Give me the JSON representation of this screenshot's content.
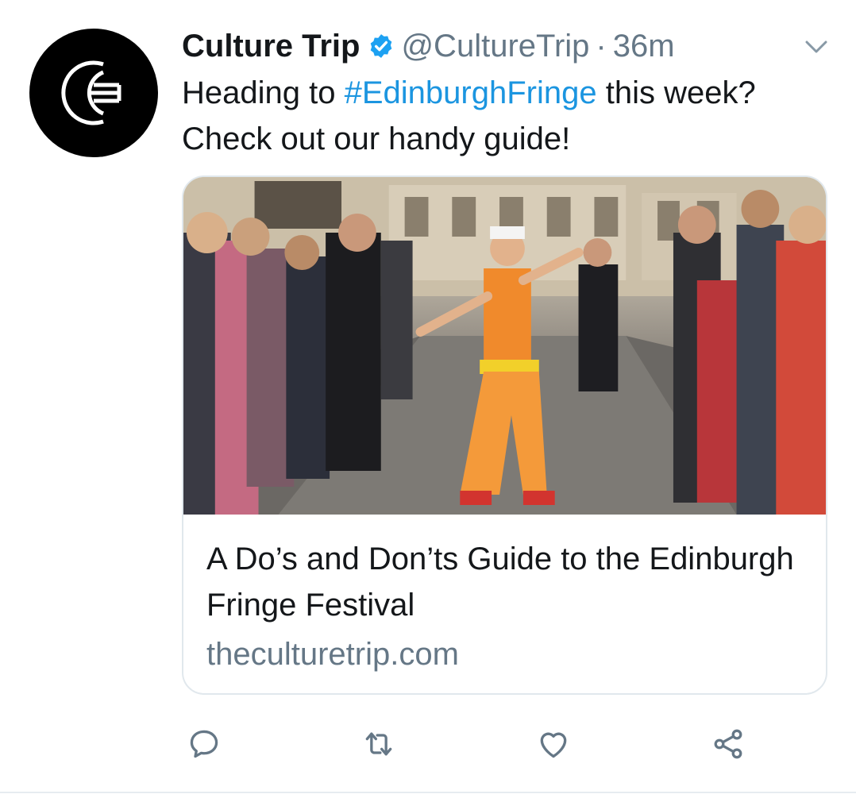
{
  "tweet": {
    "author_name": "Culture Trip",
    "verified": true,
    "handle": "@CultureTrip",
    "separator": "·",
    "time": "36m",
    "text_before": "Heading to ",
    "hashtag": "#EdinburghFringe",
    "text_after": " this week? Check out our handy guide!"
  },
  "card": {
    "title": "A Do’s and Don’ts Guide to the Edinburgh Fringe Festival",
    "domain": "theculturetrip.com",
    "image_description_icon": "festival-street-photo"
  },
  "actions": [
    "reply-icon",
    "retweet-icon",
    "like-icon",
    "share-icon"
  ],
  "colors": {
    "link": "#1b95e0",
    "secondary": "#657786",
    "verified": "#1da1f2",
    "avatar_bg": "#000000"
  }
}
